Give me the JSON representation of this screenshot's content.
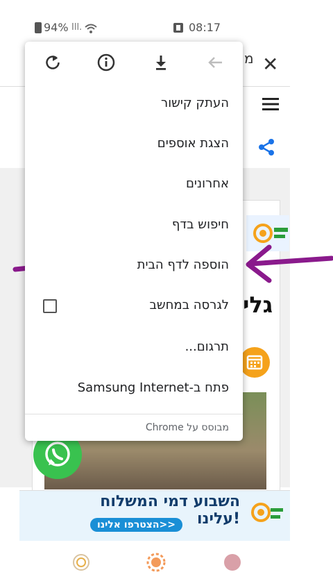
{
  "status_bar": {
    "battery": "94%",
    "time": "08:17"
  },
  "page": {
    "title_fragment": "מ",
    "heading_fragment": "גלי",
    "banner_text": "השבוע דמי המשלוח עלינו!",
    "banner_button": "הצטרפו אלינו>>"
  },
  "menu": {
    "toolbar": [
      "refresh-icon",
      "info-icon",
      "download-icon",
      "back-arrow-icon"
    ],
    "items": [
      "העתק קישור",
      "הצגת אוספים",
      "אחרונים",
      "חיפוש בדף",
      "הוספה לדף הבית",
      "לגרסה במחשב",
      "תרגום...",
      "פתח ב-Samsung Internet"
    ],
    "desktop_checkbox_checked": false,
    "footer": "מבוסס על Chrome"
  },
  "colors": {
    "highlight": "#f4f000",
    "arrow": "#8a1a8c",
    "share": "#1a73e8"
  }
}
